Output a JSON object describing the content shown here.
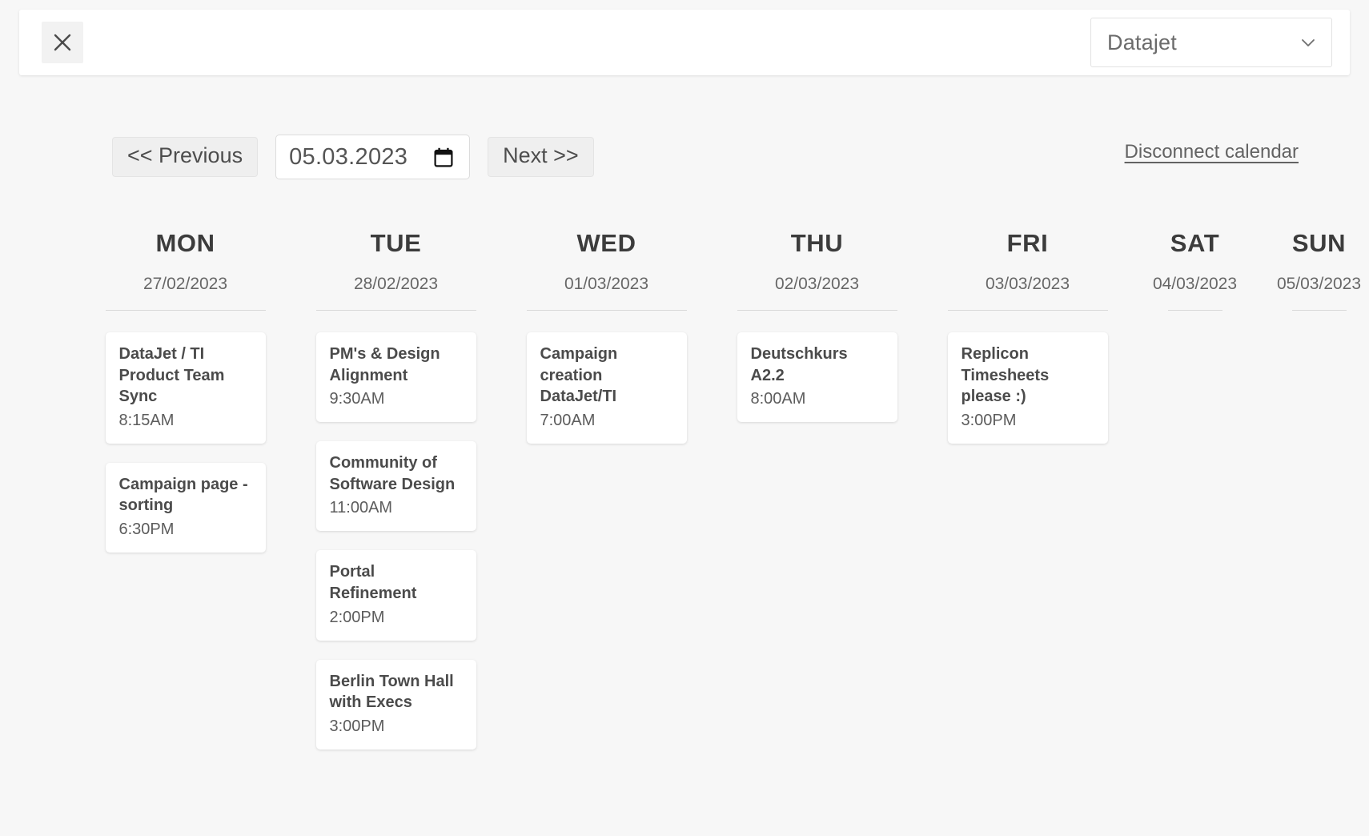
{
  "topbar": {
    "close_icon": "close-icon",
    "account_select": {
      "value": "Datajet",
      "chevron_icon": "chevron-down-icon"
    }
  },
  "toolbar": {
    "previous_label": "<< Previous",
    "next_label": "Next >>",
    "date_value": "05.03.2023",
    "calendar_icon": "calendar-icon",
    "disconnect_label": "Disconnect calendar"
  },
  "week": {
    "days": [
      {
        "name": "MON",
        "date": "27/02/2023",
        "narrow": false,
        "events": [
          {
            "title": "DataJet / TI Product Team Sync",
            "time": "8:15AM"
          },
          {
            "title": "Campaign page - sorting",
            "time": "6:30PM"
          }
        ]
      },
      {
        "name": "TUE",
        "date": "28/02/2023",
        "narrow": false,
        "events": [
          {
            "title": "PM's & Design Alignment",
            "time": "9:30AM"
          },
          {
            "title": "Community of Software Design",
            "time": "11:00AM"
          },
          {
            "title": "Portal Refinement",
            "time": "2:00PM"
          },
          {
            "title": "Berlin Town Hall with Execs",
            "time": "3:00PM"
          }
        ]
      },
      {
        "name": "WED",
        "date": "01/03/2023",
        "narrow": false,
        "events": [
          {
            "title": "Campaign creation DataJet/TI",
            "time": "7:00AM"
          }
        ]
      },
      {
        "name": "THU",
        "date": "02/03/2023",
        "narrow": false,
        "events": [
          {
            "title": "Deutschkurs A2.2",
            "time": "8:00AM"
          }
        ]
      },
      {
        "name": "FRI",
        "date": "03/03/2023",
        "narrow": false,
        "events": [
          {
            "title": "Replicon Timesheets please :)",
            "time": "3:00PM"
          }
        ]
      },
      {
        "name": "SAT",
        "date": "04/03/2023",
        "narrow": true,
        "events": []
      },
      {
        "name": "SUN",
        "date": "05/03/2023",
        "narrow": true,
        "events": []
      }
    ]
  }
}
